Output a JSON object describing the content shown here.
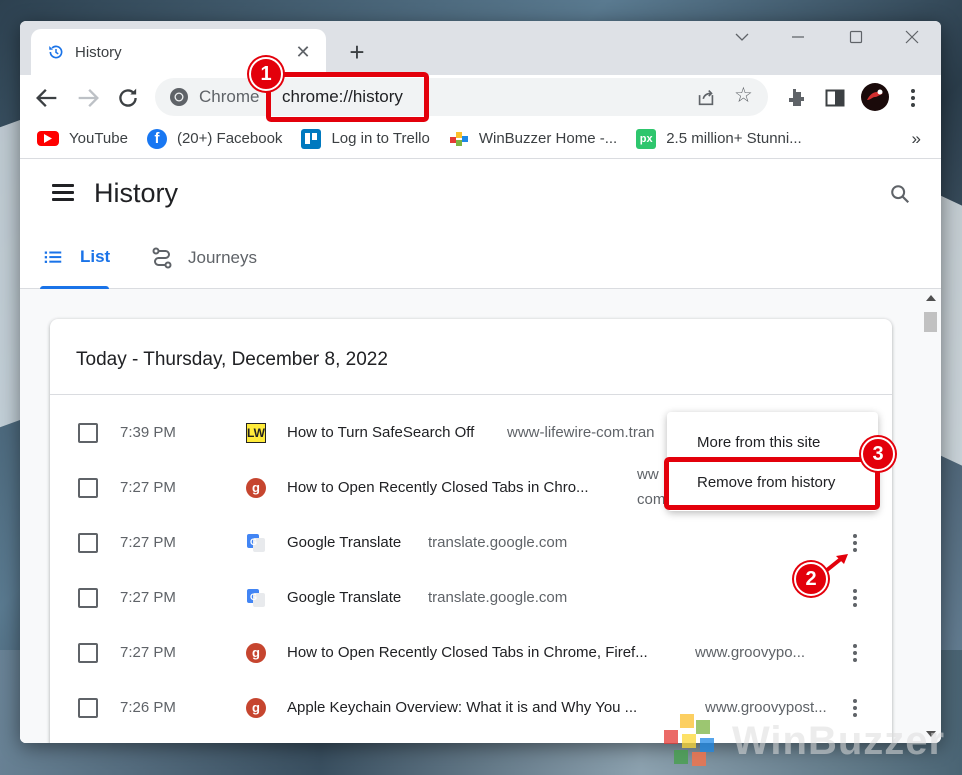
{
  "browser": {
    "tab_title": "History",
    "new_tab_symbol": "+",
    "omnibox_chip": "Chrome",
    "url": "chrome://history"
  },
  "bookmarks": [
    {
      "label": "YouTube",
      "icon": "youtube-icon",
      "color": "#ff0000"
    },
    {
      "label": "(20+) Facebook",
      "icon": "facebook-icon",
      "color": "#1877f2"
    },
    {
      "label": "Log in to Trello",
      "icon": "trello-icon",
      "color": "#0079bf"
    },
    {
      "label": "WinBuzzer Home -...",
      "icon": "winbuzzer-icon",
      "color": "#7cb342"
    },
    {
      "label": "2.5 million+ Stunni...",
      "icon": "pixabay-icon",
      "color": "#2ec66d"
    }
  ],
  "bookmarks_more": "»",
  "history": {
    "title": "History",
    "tabs": {
      "list": "List",
      "journeys": "Journeys"
    },
    "date_heading": "Today - Thursday, December 8, 2022",
    "rows": [
      {
        "time": "7:39 PM",
        "title": "How to Turn SafeSearch Off",
        "domain": "www-lifewire-com.tran",
        "icon": "lifewire-icon"
      },
      {
        "time": "7:27 PM",
        "title": "How to Open Recently Closed Tabs in Chro...",
        "domain": "ww",
        "domain2": "com",
        "icon": "groovypost-icon"
      },
      {
        "time": "7:27 PM",
        "title": "Google Translate",
        "domain": "translate.google.com",
        "icon": "google-translate-icon"
      },
      {
        "time": "7:27 PM",
        "title": "Google Translate",
        "domain": "translate.google.com",
        "icon": "google-translate-icon"
      },
      {
        "time": "7:27 PM",
        "title": "How to Open Recently Closed Tabs in Chrome, Firef...",
        "domain": "www.groovypo...",
        "icon": "groovypost-icon"
      },
      {
        "time": "7:26 PM",
        "title": "Apple Keychain Overview: What it is and Why You ...",
        "domain": "www.groovypost...",
        "icon": "groovypost-icon"
      }
    ]
  },
  "context_menu": {
    "more_from_site": "More from this site",
    "remove": "Remove from history"
  },
  "annotations": {
    "one": "1",
    "two": "2",
    "three": "3",
    "color": "#e3000b"
  },
  "watermark": "WinBuzzer"
}
